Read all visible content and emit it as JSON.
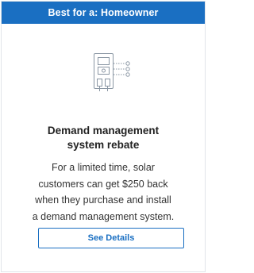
{
  "card": {
    "banner": "Best for a: Homeowner",
    "icon": "demand-management-device-icon",
    "title_lines": [
      "Demand management",
      "system rebate"
    ],
    "description_lines": [
      "For a limited time, solar",
      "customers can get $250 back",
      "when they purchase and install",
      "a demand management system."
    ],
    "button_label": "See Details"
  },
  "colors": {
    "accent": "#1a6fc2",
    "text": "#222222",
    "icon_stroke": "#8a96a3"
  }
}
